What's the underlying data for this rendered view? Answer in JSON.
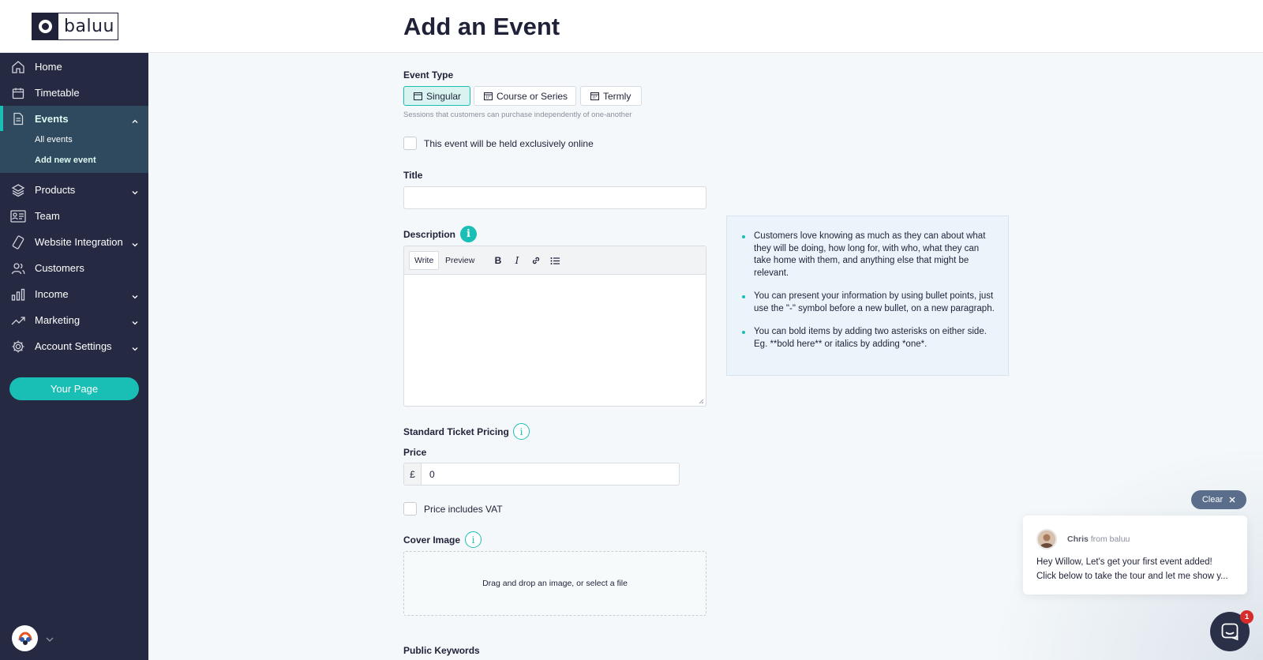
{
  "brand": {
    "name": "baluu"
  },
  "page": {
    "title": "Add an Event"
  },
  "sidebar": {
    "items": [
      {
        "label": "Home",
        "icon": "home-icon"
      },
      {
        "label": "Timetable",
        "icon": "calendar-icon"
      },
      {
        "label": "Events",
        "icon": "document-icon",
        "expanded": true
      },
      {
        "label": "Products",
        "icon": "layers-icon"
      },
      {
        "label": "Team",
        "icon": "team-icon"
      },
      {
        "label": "Website Integration",
        "icon": "link-icon"
      },
      {
        "label": "Customers",
        "icon": "users-icon"
      },
      {
        "label": "Income",
        "icon": "bar-chart-icon"
      },
      {
        "label": "Marketing",
        "icon": "trend-icon"
      },
      {
        "label": "Account Settings",
        "icon": "gear-icon"
      }
    ],
    "events_sub": [
      "All events",
      "Add new event"
    ],
    "your_page": "Your Page"
  },
  "form": {
    "event_type_label": "Event Type",
    "event_types": [
      "Singular",
      "Course or Series",
      "Termly"
    ],
    "event_type_selected": "Singular",
    "event_type_hint": "Sessions that customers can purchase independently of one-another",
    "online_label": "This event will be held exclusively online",
    "title_label": "Title",
    "title_value": "",
    "description_label": "Description",
    "editor_tabs": [
      "Write",
      "Preview"
    ],
    "description_value": "",
    "tips": [
      "Customers love knowing as much as they can about what they will be doing, how long for, with who, what they can take home with them, and anything else that might be relevant.",
      "You can present your information by using bullet points, just use the \"-\" symbol before a new bullet, on a new paragraph.",
      "You can bold items by adding two asterisks on either side. Eg. **bold here** or italics by adding *one*."
    ],
    "pricing_label": "Standard Ticket Pricing",
    "price_label": "Price",
    "currency": "£",
    "price_value": "0",
    "vat_label": "Price includes VAT",
    "cover_label": "Cover Image",
    "dropzone_text": "Drag and drop an image, or select a file",
    "keywords_label": "Public Keywords"
  },
  "chat": {
    "clear": "Clear",
    "sender": "Chris",
    "from": "from baluu",
    "line1": "Hey Willow, Let's get your first event added!",
    "line2": "Click below to take the tour and let me show y...",
    "badge": "1"
  },
  "colors": {
    "accent": "#19bfb4",
    "sidebar": "#252a42",
    "active_nav": "#2f4a5e",
    "badge": "#d62c2c"
  }
}
